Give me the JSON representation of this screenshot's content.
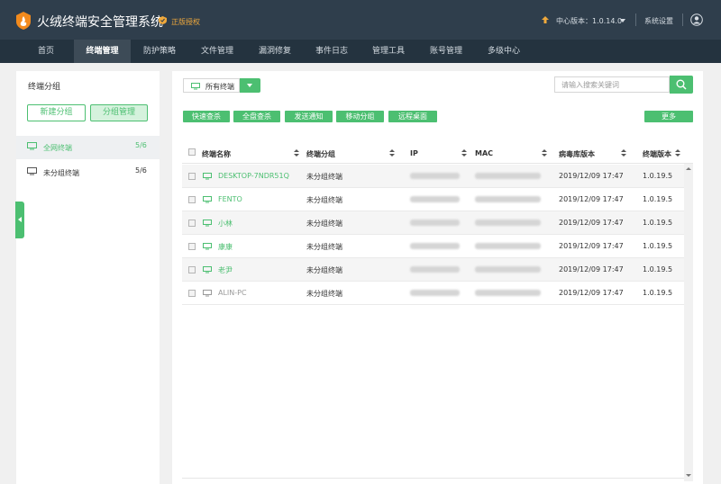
{
  "app": {
    "title": "火绒终端安全管理系统",
    "auth_label": "正版授权"
  },
  "header": {
    "version_label": "中心版本：1.0.14.0",
    "settings_label": "系统设置"
  },
  "nav": [
    {
      "label": "首页"
    },
    {
      "label": "终端管理",
      "active": true
    },
    {
      "label": "防护策略"
    },
    {
      "label": "文件管理"
    },
    {
      "label": "漏洞修复"
    },
    {
      "label": "事件日志"
    },
    {
      "label": "管理工具"
    },
    {
      "label": "账号管理"
    },
    {
      "label": "多级中心"
    }
  ],
  "sidebar": {
    "title": "终端分组",
    "new_group": "新建分组",
    "manage_group": "分组管理",
    "groups": [
      {
        "label": "全网终端",
        "count": "5/6",
        "active": true
      },
      {
        "label": "未分组终端",
        "count": "5/6"
      }
    ]
  },
  "toolbar": {
    "terminal_select": "所有终端",
    "search_placeholder": "请输入搜索关键词",
    "actions": [
      "快速查杀",
      "全盘查杀",
      "发送通知",
      "移动分组",
      "远程桌面"
    ],
    "more": "更多"
  },
  "table": {
    "columns": [
      "终端名称",
      "终端分组",
      "IP",
      "MAC",
      "病毒库版本",
      "终端版本"
    ],
    "rows": [
      {
        "name": "DESKTOP-7NDR51Q",
        "group": "未分组终端",
        "virus_db": "2019/12/09 17:47",
        "client_version": "1.0.19.5",
        "online": true
      },
      {
        "name": "FENTO",
        "group": "未分组终端",
        "virus_db": "2019/12/09 17:47",
        "client_version": "1.0.19.5",
        "online": true
      },
      {
        "name": "小林",
        "group": "未分组终端",
        "virus_db": "2019/12/09 17:47",
        "client_version": "1.0.19.5",
        "online": true
      },
      {
        "name": "康康",
        "group": "未分组终端",
        "virus_db": "2019/12/09 17:47",
        "client_version": "1.0.19.5",
        "online": true
      },
      {
        "name": "老尹",
        "group": "未分组终端",
        "virus_db": "2019/12/09 17:47",
        "client_version": "1.0.19.5",
        "online": true
      },
      {
        "name": "ALIN-PC",
        "group": "未分组终端",
        "virus_db": "2019/12/09 17:47",
        "client_version": "1.0.19.5",
        "online": false
      }
    ]
  },
  "colors": {
    "accent": "#4cbf71",
    "header_bg": "#2f3e4c",
    "nav_bg": "#24333f",
    "nav_active": "#3d4b57",
    "warning": "#f0a93c",
    "offline": "#9a9a9a"
  },
  "icons": [
    "logo-icon",
    "auth-shield-icon",
    "update-arrow-icon",
    "user-avatar-icon",
    "monitor-icon",
    "search-icon",
    "sort-icon",
    "checkbox",
    "collapse-arrow-icon"
  ]
}
